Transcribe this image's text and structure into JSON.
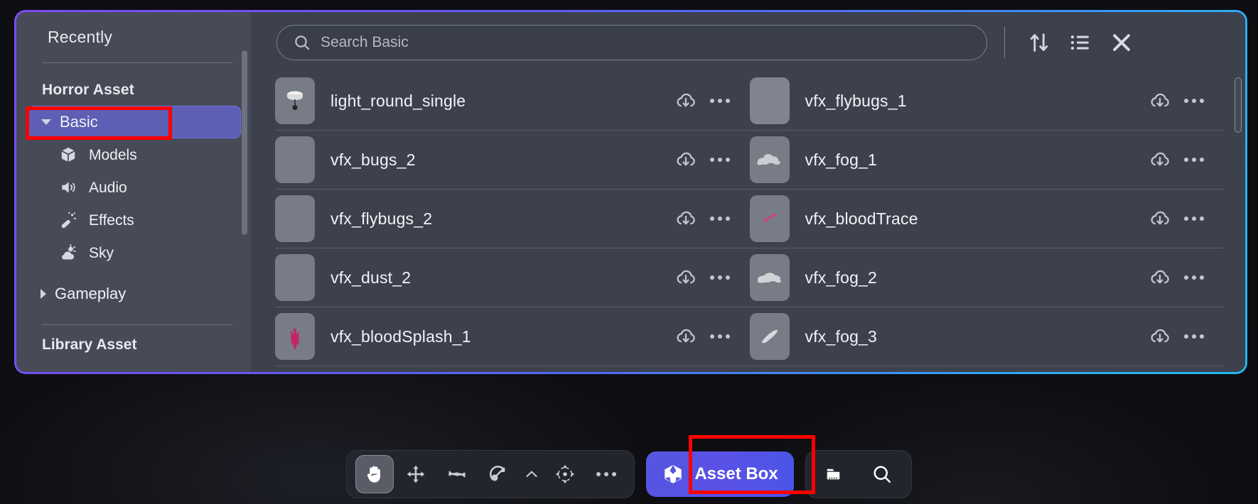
{
  "sidebar": {
    "recently_label": "Recently",
    "group_title": "Horror Asset",
    "items": [
      {
        "label": "Basic",
        "icon": "triangle-down-icon",
        "selected": true,
        "level": 0
      },
      {
        "label": "Models",
        "icon": "cube-icon",
        "selected": false,
        "level": 1
      },
      {
        "label": "Audio",
        "icon": "speaker-icon",
        "selected": false,
        "level": 1
      },
      {
        "label": "Effects",
        "icon": "magic-wand-icon",
        "selected": false,
        "level": 1
      },
      {
        "label": "Sky",
        "icon": "cloud-sun-icon",
        "selected": false,
        "level": 1
      },
      {
        "label": "Gameplay",
        "icon": "triangle-right-icon",
        "selected": false,
        "level": 0
      }
    ],
    "group_title2": "Library Asset"
  },
  "search": {
    "placeholder": "Search Basic",
    "value": "",
    "icon": "search-icon"
  },
  "toolbar_top": {
    "sort_icon": "sort-arrows-icon",
    "list_view_icon": "list-view-icon",
    "close_icon": "close-icon"
  },
  "assets": {
    "download_icon": "cloud-download-icon",
    "more_icon": "more-horizontal-icon",
    "left_column": [
      {
        "name": "light_round_single",
        "thumb": "lamp-thumb"
      },
      {
        "name": "vfx_bugs_2",
        "thumb": "bugs-thumb"
      },
      {
        "name": "vfx_flybugs_2",
        "thumb": "flybugs-thumb"
      },
      {
        "name": "vfx_dust_2",
        "thumb": "dust-thumb"
      },
      {
        "name": "vfx_bloodSplash_1",
        "thumb": "bloodsplash-thumb"
      }
    ],
    "right_column": [
      {
        "name": "vfx_flybugs_1",
        "thumb": "flybugs-thumb"
      },
      {
        "name": "vfx_fog_1",
        "thumb": "fog-thumb"
      },
      {
        "name": "vfx_bloodTrace",
        "thumb": "bloodtrace-thumb"
      },
      {
        "name": "vfx_fog_2",
        "thumb": "fog-thumb"
      },
      {
        "name": "vfx_fog_3",
        "thumb": "fogstreak-thumb"
      }
    ]
  },
  "bottom_toolbar": {
    "tools": [
      {
        "name": "hand-tool",
        "icon": "hand-icon",
        "active": true
      },
      {
        "name": "move-tool",
        "icon": "move-arrows-icon",
        "active": false
      },
      {
        "name": "rotate-tool",
        "icon": "rotate-icon",
        "active": false
      },
      {
        "name": "scale-tool",
        "icon": "scale-arrow-icon",
        "active": false
      },
      {
        "name": "expand-tool",
        "icon": "chevron-up-icon",
        "active": false
      },
      {
        "name": "gizmo-tool",
        "icon": "gizmo-icon",
        "active": false
      },
      {
        "name": "more-tools",
        "icon": "more-horizontal-icon",
        "active": false
      }
    ],
    "asset_box": {
      "label": "Asset Box",
      "icon": "cube-icon"
    },
    "right_tools": [
      {
        "name": "folder-button",
        "icon": "folder-icon"
      },
      {
        "name": "search-button",
        "icon": "search-icon"
      }
    ]
  },
  "colors": {
    "accent_purple": "#5c5fb4",
    "accent_blue": "#5555e0",
    "panel_border_gradient_start": "#7b4cf0",
    "panel_border_gradient_end": "#22b8ef",
    "annotation_red": "#fe0000",
    "panel_bg": "#3d414e",
    "sidebar_bg": "#474b58"
  }
}
